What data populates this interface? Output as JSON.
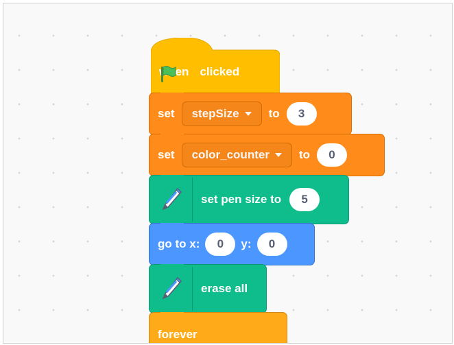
{
  "script": {
    "when_flag": {
      "label_when": "when",
      "label_clicked": "clicked",
      "flag_color": "#4cbf56"
    },
    "set_step": {
      "label_set": "set",
      "variable": "stepSize",
      "label_to": "to",
      "value": "3"
    },
    "set_color": {
      "label_set": "set",
      "variable": "color_counter",
      "label_to": "to",
      "value": "0"
    },
    "pen_size": {
      "icon": "pen-icon",
      "label": "set pen size to",
      "value": "5"
    },
    "goto": {
      "label_x": "go to x:",
      "x": "0",
      "label_y": "y:",
      "y": "0"
    },
    "erase": {
      "icon": "pen-icon",
      "label": "erase all"
    },
    "forever": {
      "label": "forever"
    }
  },
  "colors": {
    "events": "#ffbf00",
    "variables": "#ff8c1a",
    "pen": "#0fbd8c",
    "motion": "#4c97ff",
    "control": "#ffab19"
  }
}
